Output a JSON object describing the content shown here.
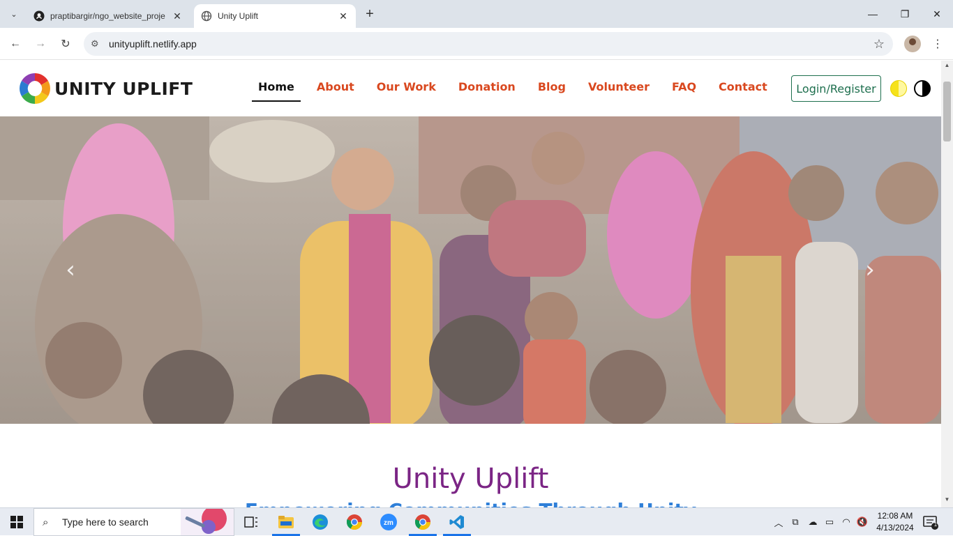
{
  "browser": {
    "tabs": [
      {
        "title": "praptibargir/ngo_website_proje",
        "favicon": "github-icon",
        "active": false
      },
      {
        "title": "Unity Uplift",
        "favicon": "globe-icon",
        "active": true
      }
    ],
    "url": "unityuplift.netlify.app"
  },
  "site": {
    "logo_text": "UNITY UPLIFT",
    "nav": [
      {
        "label": "Home",
        "active": true
      },
      {
        "label": "About"
      },
      {
        "label": "Our Work"
      },
      {
        "label": "Donation"
      },
      {
        "label": "Blog"
      },
      {
        "label": "Volunteer"
      },
      {
        "label": "FAQ"
      },
      {
        "label": "Contact"
      }
    ],
    "login_label": "Login/Register",
    "hero": {
      "prev": "‹",
      "next": "›"
    },
    "intro_title": "Unity Uplift",
    "intro_subtitle": "Empowering Communities Through Unity"
  },
  "colors": {
    "nav_link": "#d9481f",
    "nav_active": "#111111",
    "login_border": "#1e6f4e",
    "intro_title": "#7b2585",
    "intro_subtitle": "#2f7fd8"
  },
  "taskbar": {
    "search_placeholder": "Type here to search",
    "time": "12:08 AM",
    "date": "4/13/2024",
    "notification_count": "1"
  }
}
